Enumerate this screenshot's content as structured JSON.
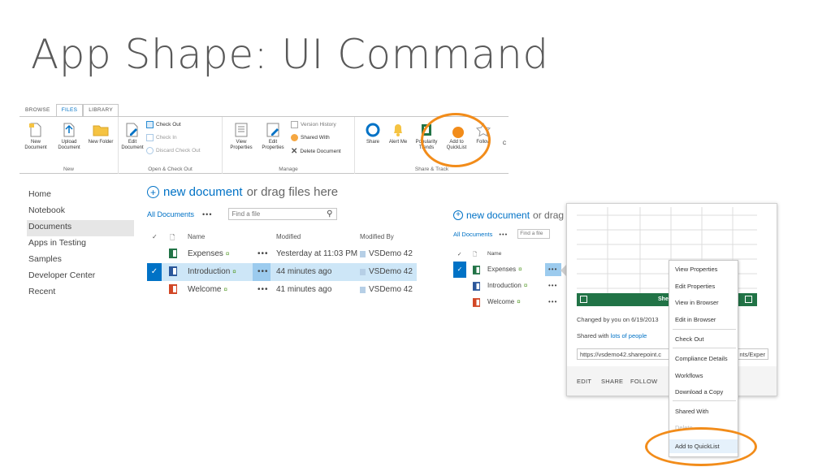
{
  "slide": {
    "title": "App Shape: UI Command"
  },
  "ribbon": {
    "tabs": [
      "BROWSE",
      "FILES",
      "LIBRARY"
    ],
    "groups": {
      "new": {
        "label": "New",
        "buttons": [
          "New Document",
          "Upload Document",
          "New Folder"
        ]
      },
      "checkout": {
        "label": "Open & Check Out",
        "edit_document": "Edit Document",
        "check_out": "Check Out",
        "check_in": "Check In",
        "discard": "Discard Check Out"
      },
      "manage": {
        "label": "Manage",
        "view_properties": "View Properties",
        "edit_properties": "Edit Properties",
        "version_history": "Version History",
        "shared_with": "Shared With",
        "delete_document": "Delete Document"
      },
      "share": {
        "label": "Share & Track",
        "share": "Share",
        "alert_me": "Alert Me",
        "popularity": "Popularity Trends",
        "add_to_quicklist": "Add to QuickList",
        "follow": "Follow",
        "cut_letter": "C"
      }
    }
  },
  "leftnav": [
    "Home",
    "Notebook",
    "Documents",
    "Apps in Testing",
    "Samples",
    "Developer Center",
    "Recent"
  ],
  "library": {
    "new_document": "new document",
    "drag_text": "or drag files here",
    "view_name": "All Documents",
    "more_dots": "•••",
    "find_placeholder": "Find a file",
    "headers": {
      "name": "Name",
      "modified": "Modified",
      "modified_by": "Modified By"
    },
    "rows": [
      {
        "name": "Expenses",
        "modified": "Yesterday at 11:03 PM",
        "modified_by": "VSDemo 42",
        "type": "excel"
      },
      {
        "name": "Introduction",
        "modified": "44 minutes ago",
        "modified_by": "VSDemo 42",
        "type": "word"
      },
      {
        "name": "Welcome",
        "modified": "41 minutes ago",
        "modified_by": "VSDemo 42",
        "type": "powerpoint"
      }
    ],
    "new_mark": "¤"
  },
  "right_panel": {
    "new_document": "new document",
    "drag_text": "or drag",
    "view_name": "All Documents",
    "find_placeholder": "Find a file",
    "header_name": "Name",
    "rows": [
      "Expenses",
      "Introduction",
      "Welcome"
    ]
  },
  "callout": {
    "sheet_title": "Shee",
    "changed_by": "Changed by you on 6/19/2013",
    "shared_with_prefix": "Shared with",
    "shared_with_link": "lots of people",
    "url_start": "https://vsdemo42.sharepoint.c",
    "url_end": "nts/Exper",
    "footer": [
      "EDIT",
      "SHARE",
      "FOLLOW"
    ]
  },
  "context_menu": {
    "items": [
      "View Properties",
      "Edit Properties",
      "View in Browser",
      "Edit in Browser",
      "Check Out",
      "Compliance Details",
      "Workflows",
      "Download a Copy",
      "Shared With",
      "Delete",
      "Add to QuickList"
    ]
  },
  "colors": {
    "accent": "#0072c6",
    "highlight": "#f28c1a",
    "excel_green": "#217346",
    "selected_row": "#cde6f7"
  }
}
